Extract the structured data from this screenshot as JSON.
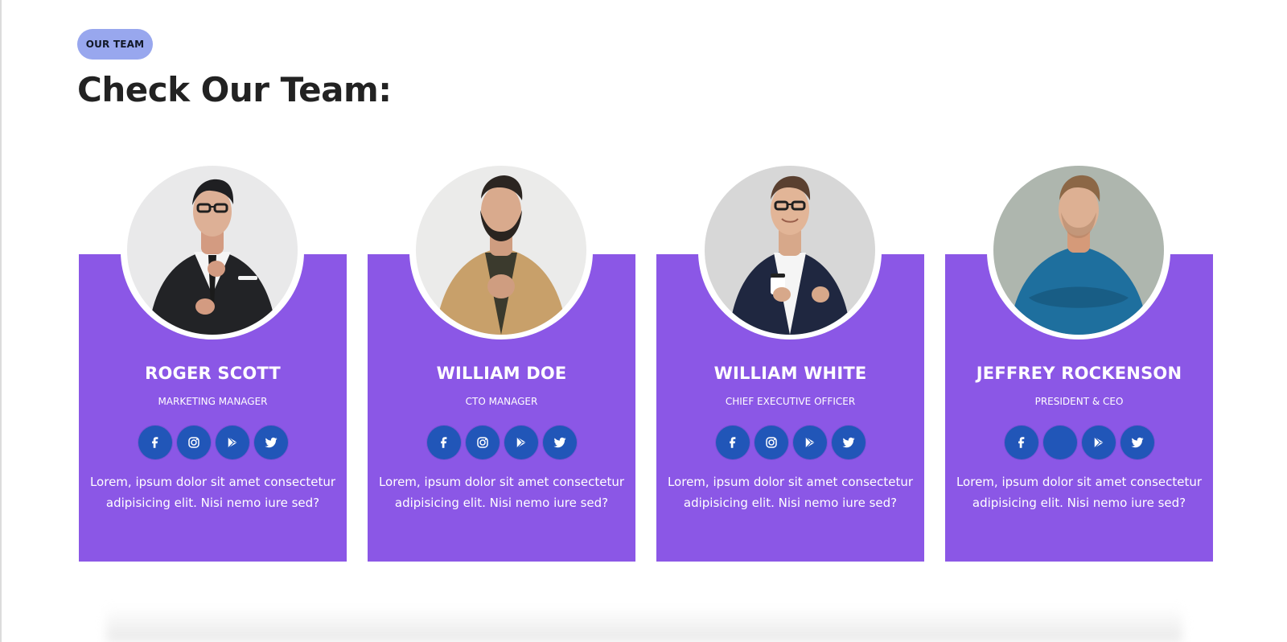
{
  "section": {
    "badge": "OUR TEAM",
    "title": "Check Our Team:"
  },
  "members": [
    {
      "name": "ROGER SCOTT",
      "role": "MARKETING MANAGER",
      "bio": "Lorem, ipsum dolor sit amet consectetur adipisicing elit. Nisi nemo iure sed?",
      "photo": "man-black-suit-glasses-portrait",
      "socials": [
        "facebook-icon",
        "instagram-icon",
        "play-store-icon",
        "twitter-icon"
      ]
    },
    {
      "name": "WILLIAM DOE",
      "role": "CTO MANAGER",
      "bio": "Lorem, ipsum dolor sit amet consectetur adipisicing elit. Nisi nemo iure sed?",
      "photo": "bearded-man-camel-coat-portrait",
      "socials": [
        "facebook-icon",
        "instagram-icon",
        "play-store-icon",
        "twitter-icon"
      ]
    },
    {
      "name": "WILLIAM WHITE",
      "role": "CHIEF EXECUTIVE OFFICER",
      "bio": "Lorem, ipsum dolor sit amet consectetur adipisicing elit. Nisi nemo iure sed?",
      "photo": "man-navy-blazer-coffee-portrait",
      "socials": [
        "facebook-icon",
        "instagram-icon",
        "play-store-icon",
        "twitter-icon"
      ]
    },
    {
      "name": "JEFFREY ROCKENSON",
      "role": "PRESIDENT & CEO",
      "bio": "Lorem, ipsum dolor sit amet consectetur adipisicing elit. Nisi nemo iure sed?",
      "photo": "man-teal-shirt-crossed-arms-portrait",
      "socials": [
        "facebook-icon",
        "instagram-hidden",
        "play-store-icon",
        "twitter-icon"
      ]
    }
  ],
  "colors": {
    "badge_bg": "#98a7ee",
    "card_bg": "#8b57e6",
    "social_bg": "#2156b8",
    "title_text": "#222222"
  }
}
